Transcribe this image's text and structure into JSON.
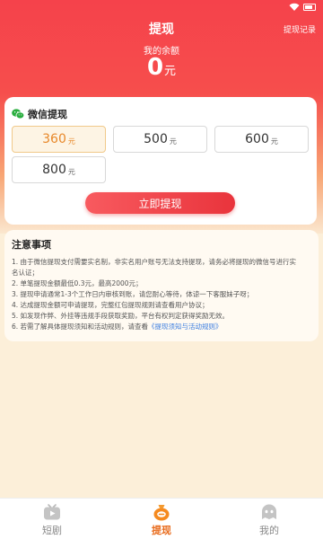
{
  "header": {
    "title": "提现",
    "record_link": "提现记录",
    "balance_label": "我的余额",
    "balance_value": "0",
    "balance_unit": "元"
  },
  "withdraw_card": {
    "title": "微信提现",
    "amounts": [
      {
        "value": "360",
        "unit": "元",
        "selected": true
      },
      {
        "value": "500",
        "unit": "元",
        "selected": false
      },
      {
        "value": "600",
        "unit": "元",
        "selected": false
      },
      {
        "value": "800",
        "unit": "元",
        "selected": false
      }
    ],
    "button_label": "立即提现"
  },
  "notice": {
    "title": "注意事项",
    "lines": [
      "1. 由于微信提现支付需要实名制，非实名用户账号无法支持提现，请务必将提现的微信号进行实",
      "名认证；",
      "2. 单笔提现金额最低0.3元，最高2000元；",
      "3. 提现申请通常1-3个工作日内审核到账，请您耐心等待，体谅一下客服妹子呀；",
      "4. 达成提现金额可申请提现，完整红包提现规则请查看用户协议；",
      "5. 如发现作弊、外挂等违规手段获取奖励，平台有权判定获得奖励无效。",
      "6. 若需了解具体提现须知和活动规则，请查看"
    ],
    "link_text": "《提现须知与活动规则》"
  },
  "tabbar": {
    "items": [
      {
        "label": "短剧",
        "active": false
      },
      {
        "label": "提现",
        "active": true
      },
      {
        "label": "我的",
        "active": false
      }
    ]
  },
  "colors": {
    "brand_red": "#f5424b",
    "accent_orange": "#e86a1a",
    "page_bg": "#fcefd9",
    "link_blue": "#3b7de0"
  },
  "icons": {
    "wechat": "wechat-icon",
    "drama_tab": "play-tv-icon",
    "withdraw_tab": "coin-bag-icon",
    "mine_tab": "ghost-face-icon"
  }
}
